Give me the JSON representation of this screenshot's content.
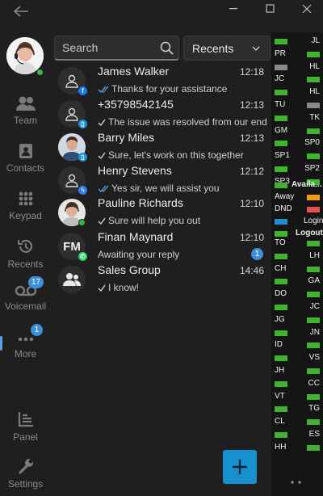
{
  "titlebar": {
    "back_icon": "arrow-left-icon",
    "controls": [
      "minimize-icon",
      "maximize-icon",
      "close-icon"
    ]
  },
  "nav": {
    "presence_color": "#3cb44b",
    "items": [
      {
        "label": "Team",
        "icon": "team-icon"
      },
      {
        "label": "Contacts",
        "icon": "contacts-icon"
      },
      {
        "label": "Keypad",
        "icon": "keypad-icon"
      },
      {
        "label": "Recents",
        "icon": "recents-icon"
      },
      {
        "label": "Voicemail",
        "icon": "voicemail-icon",
        "badge": "17"
      },
      {
        "label": "More",
        "icon": "more-icon",
        "badge": "1"
      },
      {
        "label": "Panel",
        "icon": "panel-icon"
      },
      {
        "label": "Settings",
        "icon": "settings-icon"
      }
    ]
  },
  "search": {
    "placeholder": "Search",
    "value": ""
  },
  "filter": {
    "selected": "Recents"
  },
  "conversations": [
    {
      "name": "James Walker",
      "time": "12:18",
      "preview": "Thanks for your assistance",
      "tick": "double",
      "source": "facebook"
    },
    {
      "name": "+35798542145",
      "time": "12:13",
      "preview": "The issue was resolved from our end",
      "tick": "single",
      "source": "livechat"
    },
    {
      "name": "Barry Miles",
      "time": "12:13",
      "preview": "Sure, let's work on this together",
      "tick": "single",
      "source": "livechat"
    },
    {
      "name": "Henry Stevens",
      "time": "12:12",
      "preview": "Yes sir, we will assist you",
      "tick": "double",
      "source": "messenger"
    },
    {
      "name": "Pauline Richards",
      "time": "12:10",
      "preview": "Sure will help you out",
      "tick": "single",
      "source": "online"
    },
    {
      "name": "Finan Maynard",
      "time": "12:10",
      "preview": "Awaiting your reply",
      "tick": "none",
      "source": "whatsapp",
      "initials": "FM",
      "unread": "1"
    },
    {
      "name": "Sales Group",
      "time": "14:46",
      "preview": "I know!",
      "tick": "single",
      "source": "group"
    }
  ],
  "fab": {
    "icon": "plus-icon"
  },
  "status_panel": {
    "colors": {
      "green": "#3fb52f",
      "gray": "#8a8a8a",
      "orange": "#f29a1e",
      "red": "#e05050",
      "blue": "#1c8fd6"
    },
    "rows": [
      {
        "left_code": "",
        "left_color": "green",
        "right_code": "JL",
        "right_color": ""
      },
      {
        "left_code": "PR",
        "left_color": "",
        "right_code": "",
        "right_color": "green"
      },
      {
        "left_code": "",
        "left_color": "gray",
        "right_code": "HL",
        "right_color": ""
      },
      {
        "left_code": "JC",
        "left_color": "",
        "right_code": "",
        "right_color": "green"
      },
      {
        "left_code": "",
        "left_color": "green",
        "right_code": "HL",
        "right_color": ""
      },
      {
        "left_code": "TU",
        "left_color": "",
        "right_code": "",
        "right_color": "gray"
      },
      {
        "left_code": "",
        "left_color": "green",
        "right_code": "TK",
        "right_color": ""
      },
      {
        "left_code": "GM",
        "left_color": "",
        "right_code": "",
        "right_color": "green"
      },
      {
        "left_code": "",
        "left_color": "green",
        "right_code": "SP0",
        "right_color": ""
      },
      {
        "left_code": "SP1",
        "left_color": "",
        "right_code": "",
        "right_color": "green"
      },
      {
        "left_code": "",
        "left_color": "green",
        "right_code": "SP2",
        "right_color": ""
      },
      {
        "left_code": "SP3",
        "left_color": "",
        "right_code": "",
        "right_color": "green"
      }
    ],
    "states": [
      {
        "label": "Availa...",
        "color": "green"
      },
      {
        "label": "Away",
        "color": "orange"
      },
      {
        "label": "DND",
        "color": "red"
      },
      {
        "label": "Login",
        "color": "blue"
      },
      {
        "label": "Logout",
        "color": "green"
      }
    ],
    "rows2": [
      {
        "left_code": "TO",
        "left_color": "",
        "right_code": "",
        "right_color": "green"
      },
      {
        "left_code": "",
        "left_color": "green",
        "right_code": "LH",
        "right_color": ""
      },
      {
        "left_code": "CH",
        "left_color": "",
        "right_code": "",
        "right_color": "green"
      },
      {
        "left_code": "",
        "left_color": "green",
        "right_code": "GA",
        "right_color": ""
      },
      {
        "left_code": "DO",
        "left_color": "",
        "right_code": "",
        "right_color": "green"
      },
      {
        "left_code": "",
        "left_color": "green",
        "right_code": "JC",
        "right_color": ""
      },
      {
        "left_code": "JG",
        "left_color": "",
        "right_code": "",
        "right_color": "green"
      },
      {
        "left_code": "",
        "left_color": "green",
        "right_code": "JN",
        "right_color": ""
      },
      {
        "left_code": "ID",
        "left_color": "",
        "right_code": "",
        "right_color": "green"
      },
      {
        "left_code": "",
        "left_color": "green",
        "right_code": "VS",
        "right_color": ""
      },
      {
        "left_code": "JH",
        "left_color": "",
        "right_code": "",
        "right_color": "green"
      },
      {
        "left_code": "",
        "left_color": "green",
        "right_code": "CC",
        "right_color": ""
      },
      {
        "left_code": "VT",
        "left_color": "",
        "right_code": "",
        "right_color": "green"
      },
      {
        "left_code": "",
        "left_color": "green",
        "right_code": "TG",
        "right_color": ""
      },
      {
        "left_code": "CL",
        "left_color": "",
        "right_code": "",
        "right_color": "green"
      },
      {
        "left_code": "",
        "left_color": "green",
        "right_code": "ES",
        "right_color": ""
      },
      {
        "left_code": "HH",
        "left_color": "",
        "right_code": "",
        "right_color": "green"
      }
    ]
  }
}
